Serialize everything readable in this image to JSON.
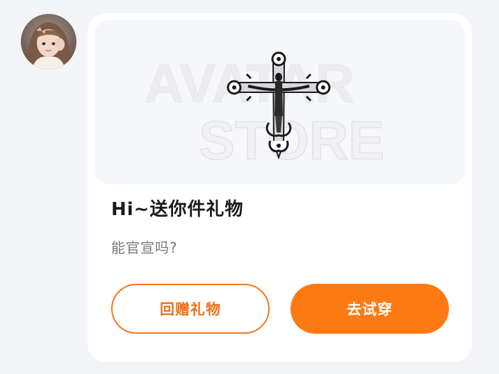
{
  "sender": {
    "avatar_icon": "user-avatar-photo"
  },
  "gift_card": {
    "banner": {
      "watermark_line1": "AVATAR",
      "watermark_line2": "STORE",
      "item_icon": "gothic-cross-icon"
    },
    "title": "Hi~送你件礼物",
    "message": "能官宣吗?",
    "buttons": {
      "return_gift_label": "回赠礼物",
      "try_on_label": "去试穿"
    }
  },
  "colors": {
    "accent": "#fd7a13",
    "page_background": "#f3f4f8",
    "card_background": "#ffffff"
  }
}
